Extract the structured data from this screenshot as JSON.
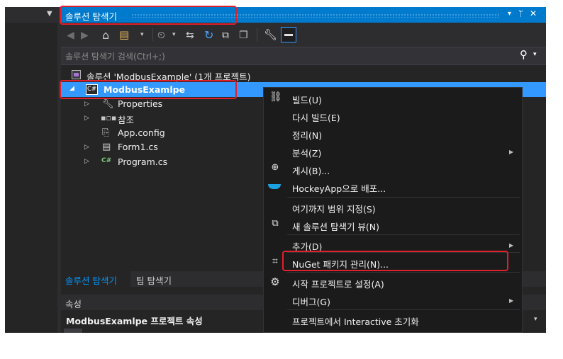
{
  "colors": {
    "accent": "#007acc",
    "selection": "#3399ff",
    "highlight_box": "#e0202a",
    "panel_bg": "#252526",
    "menu_bg": "#1b1b1c"
  },
  "solution_explorer": {
    "title": "솔루션 탐색기",
    "title_buttons": {
      "dropdown": "▾",
      "pin": "ᛘ",
      "close": "✕"
    },
    "search_placeholder": "솔루션 탐색기 검색(Ctrl+;)",
    "toolbar_icons": [
      "back-icon",
      "forward-icon",
      "home-icon",
      "switch-views-icon",
      "pending-changes-icon",
      "sync-icon",
      "refresh-icon",
      "collapse-all-icon",
      "show-all-files-icon",
      "properties-icon",
      "preview-icon"
    ],
    "tree": {
      "solution": "솔루션 'ModbusExample' (1개 프로젝트)",
      "project": "ModbusExamlpe",
      "project_icon_text": "C#",
      "items": [
        {
          "label": "Properties",
          "icon": "wrench-icon",
          "expandable": true
        },
        {
          "label": "참조",
          "icon": "references-icon",
          "expandable": true
        },
        {
          "label": "App.config",
          "icon": "config-file-icon",
          "expandable": false
        },
        {
          "label": "Form1.cs",
          "icon": "form-icon",
          "expandable": true
        },
        {
          "label": "Program.cs",
          "icon": "csharp-file-icon",
          "expandable": true
        }
      ]
    },
    "bottom_tabs": [
      "솔루션 탐색기",
      "팀 탐색기"
    ]
  },
  "properties_panel": {
    "title": "속성",
    "object": "ModbusExamlpe 프로젝트 속성"
  },
  "context_menu": {
    "items": [
      {
        "label": "빌드(U)",
        "icon": "build-icon"
      },
      {
        "label": "다시 빌드(E)",
        "icon": ""
      },
      {
        "label": "정리(N)",
        "icon": ""
      },
      {
        "label": "분석(Z)",
        "icon": "",
        "submenu": true
      },
      {
        "label": "게시(B)...",
        "icon": "publish-globe-icon"
      },
      {
        "label": "HockeyApp으로 배포...",
        "icon": "hockeyapp-icon"
      },
      {
        "label": "여기까지 범위 지정(S)",
        "icon": ""
      },
      {
        "label": "새 솔루션 탐색기 뷰(N)",
        "icon": "new-view-icon"
      },
      {
        "label": "추가(D)",
        "icon": "",
        "submenu": true
      },
      {
        "label": "NuGet 패키지 관리(N)...",
        "icon": "nuget-package-icon"
      },
      {
        "label": "시작 프로젝트로 설정(A)",
        "icon": "gear-icon"
      },
      {
        "label": "디버그(G)",
        "icon": "",
        "submenu": true
      },
      {
        "label": "프로젝트에서 Interactive 초기화",
        "icon": ""
      }
    ]
  }
}
